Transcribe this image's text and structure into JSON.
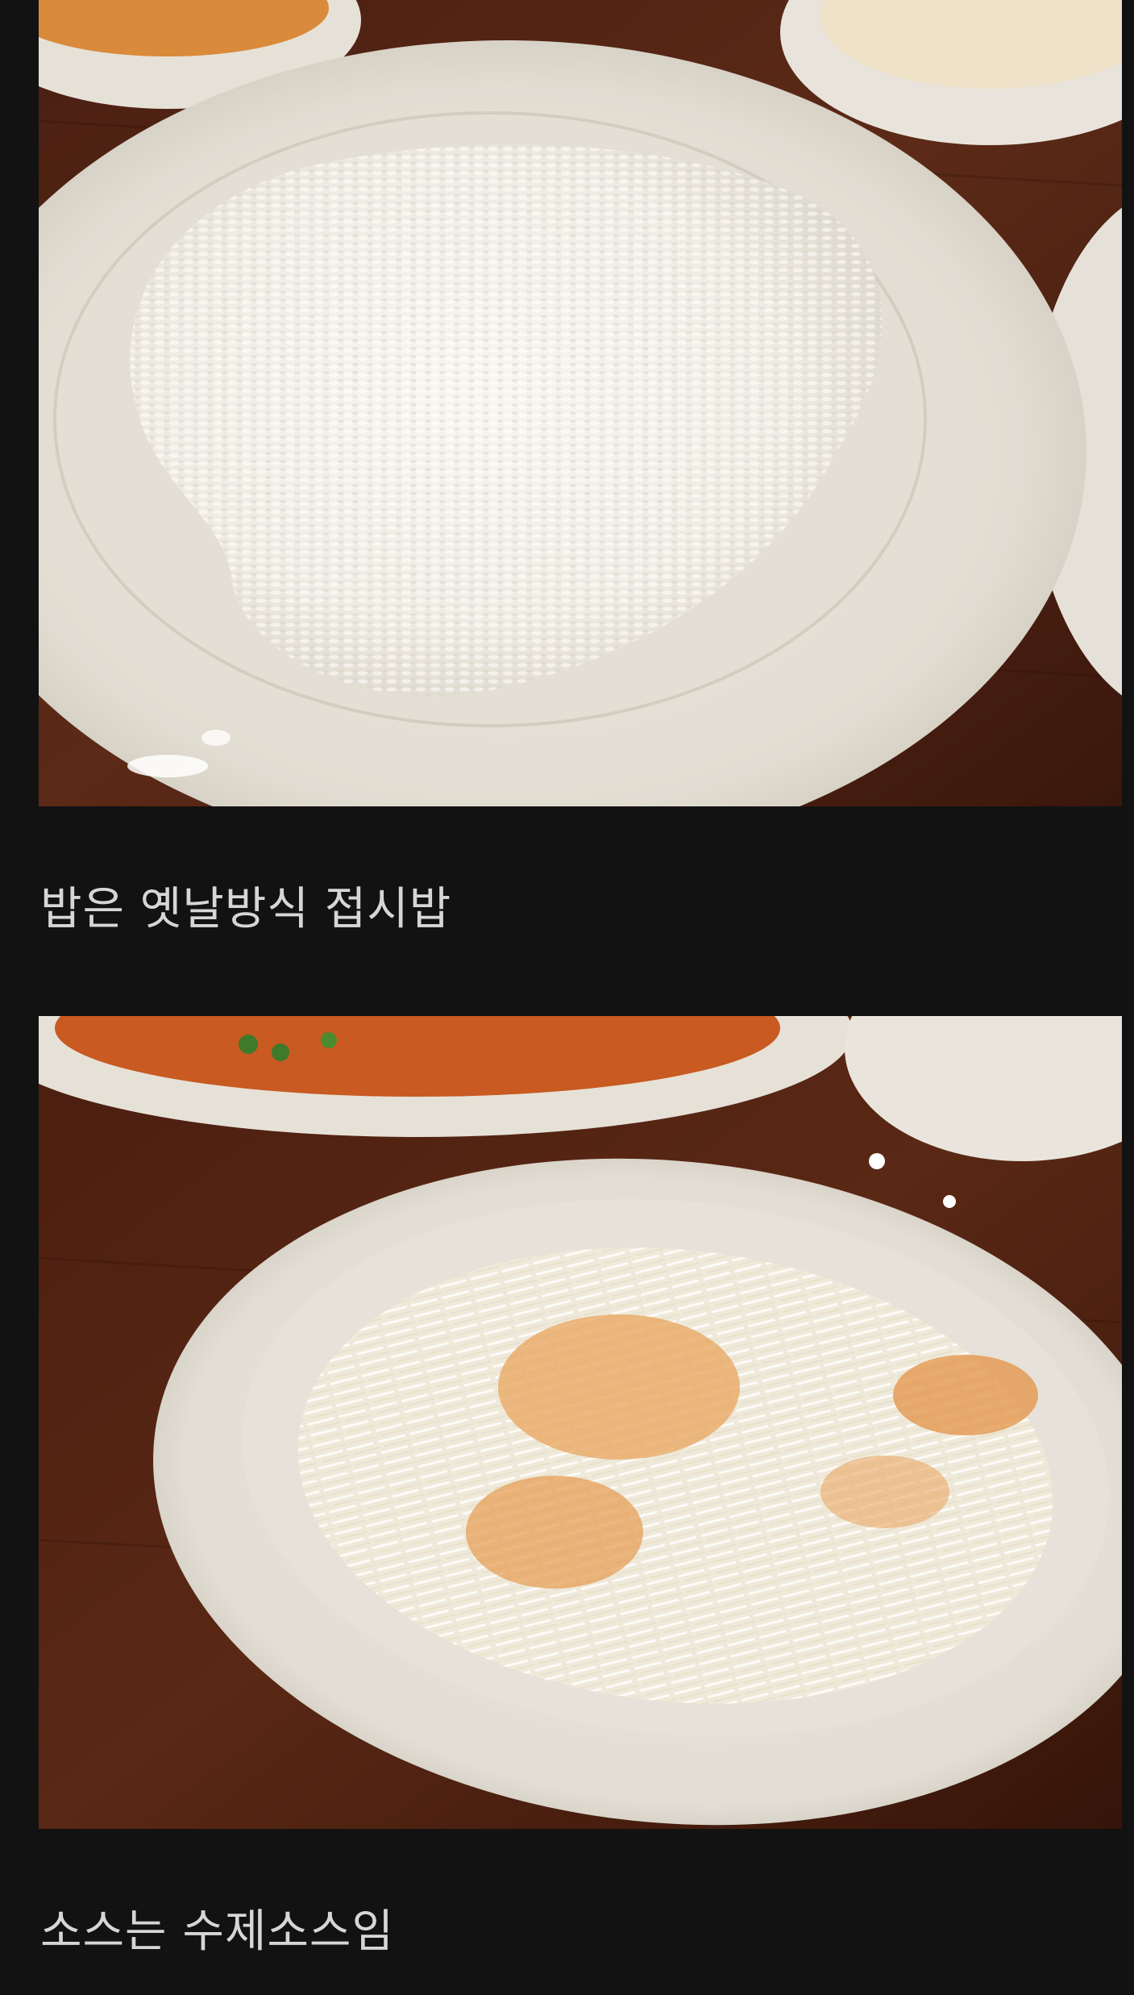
{
  "post": {
    "background": "#121212",
    "blocks": [
      {
        "type": "image",
        "icon": "rice-plate-photo"
      },
      {
        "type": "text",
        "text": "밥은 옛날방식 접시밥"
      },
      {
        "type": "image",
        "icon": "cabbage-salad-photo"
      },
      {
        "type": "text",
        "text": "소스는 수제소스임"
      }
    ]
  }
}
